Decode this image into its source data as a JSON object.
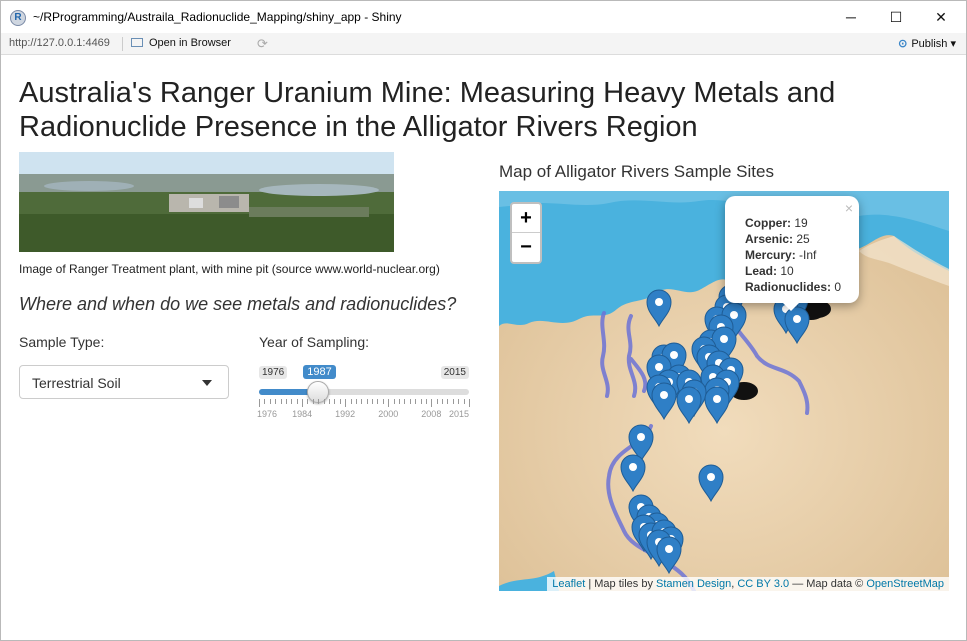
{
  "window": {
    "title": "~/RProgramming/Austraila_Radionuclide_Mapping/shiny_app - Shiny",
    "app_icon": "R",
    "minimize": "─",
    "maximize": "☐",
    "close": "✕"
  },
  "toolbar": {
    "url": "http://127.0.0.1:4469",
    "open_in_browser": "Open in Browser",
    "publish": "Publish",
    "publish_icon": "publish-icon"
  },
  "page": {
    "title": "Australia's Ranger Uranium Mine: Measuring Heavy Metals and Radionuclide Presence in the Alligator Rivers Region",
    "image_caption": "Image of Ranger Treatment plant, with mine pit (source www.world-nuclear.org)",
    "subheading": "Where and when do we see metals and radionuclides?"
  },
  "sample_type": {
    "label": "Sample Type:",
    "selected": "Terrestrial Soil"
  },
  "year_slider": {
    "label": "Year of Sampling:",
    "min": 1976,
    "max": 2015,
    "value": 1987,
    "min_label": "1976",
    "max_label": "2015",
    "value_label": "1987",
    "tick_labels": [
      "1976",
      "1984",
      "1992",
      "2000",
      "2008",
      "2015"
    ],
    "accent_color": "#428bca"
  },
  "map": {
    "title": "Map of Alligator Rivers Sample Sites",
    "zoom_in": "+",
    "zoom_out": "−",
    "popup": {
      "close": "×",
      "rows": [
        {
          "label": "Copper:",
          "value": "19"
        },
        {
          "label": "Arsenic:",
          "value": "25"
        },
        {
          "label": "Mercury:",
          "value": "-Inf"
        },
        {
          "label": "Lead:",
          "value": "10"
        },
        {
          "label": "Radionuclides:",
          "value": "0"
        }
      ]
    },
    "attribution": {
      "leaflet": "Leaflet",
      "sep1": " | Map tiles by ",
      "stamen": "Stamen Design",
      "comma": ", ",
      "license": "CC BY 3.0",
      "dash": " — Map data © ",
      "osm": "OpenStreetMap"
    },
    "marker_color": "#2f7fc6",
    "water_color": "#4ab2de"
  }
}
